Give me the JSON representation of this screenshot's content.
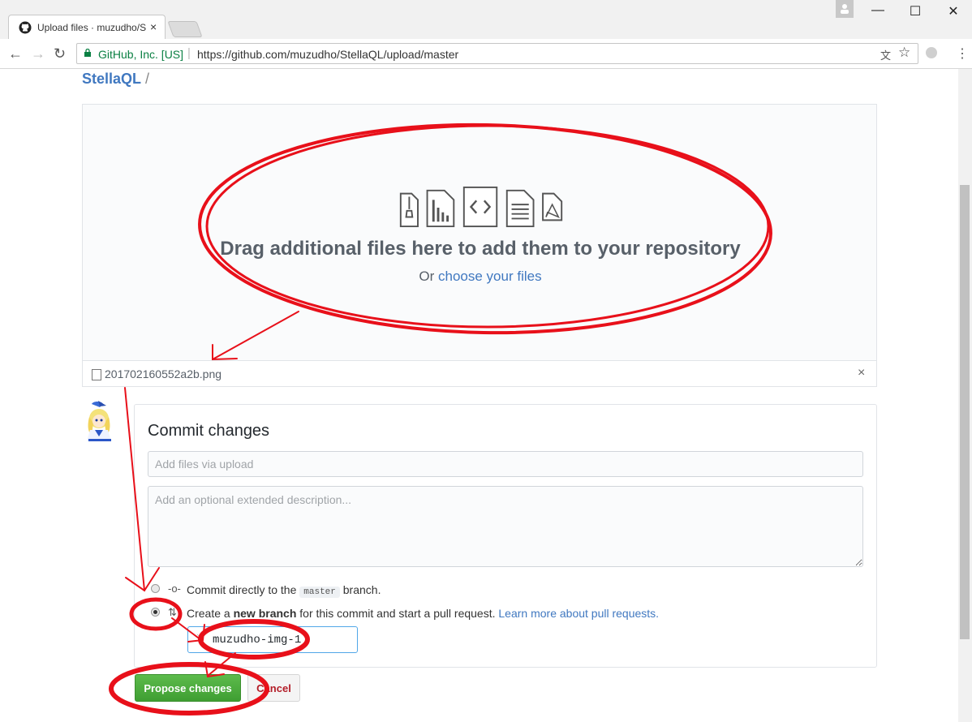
{
  "browser": {
    "tab_title": "Upload files · muzudho/S",
    "tab_close_icon": "×",
    "secure_label": "GitHub, Inc. [US]",
    "url": "https://github.com/muzudho/StellaQL/upload/master"
  },
  "page": {
    "repo_name": "StellaQL",
    "breadcrumb_sep": "/"
  },
  "dropzone": {
    "title": "Drag additional files here to add them to your repository",
    "or_text": "Or",
    "choose_link": "choose your files"
  },
  "file": {
    "name": "201702160552a2b.png",
    "remove_icon": "×"
  },
  "commit": {
    "title": "Commit changes",
    "summary_placeholder": "Add files via upload",
    "description_placeholder": "Add an optional extended description...",
    "option_direct": {
      "prefix": "Commit directly to the",
      "branch": "master",
      "suffix": "branch."
    },
    "option_new_branch": {
      "prefix": "Create a",
      "bold": "new branch",
      "suffix": "for this commit and start a pull request.",
      "link": "Learn more about pull requests."
    },
    "branch_name": "muzudho-img-1",
    "propose_label": "Propose changes",
    "cancel_label": "Cancel"
  },
  "colors": {
    "link": "#4078c0",
    "annotation": "#e8101a",
    "propose": "#4aaa3c"
  }
}
